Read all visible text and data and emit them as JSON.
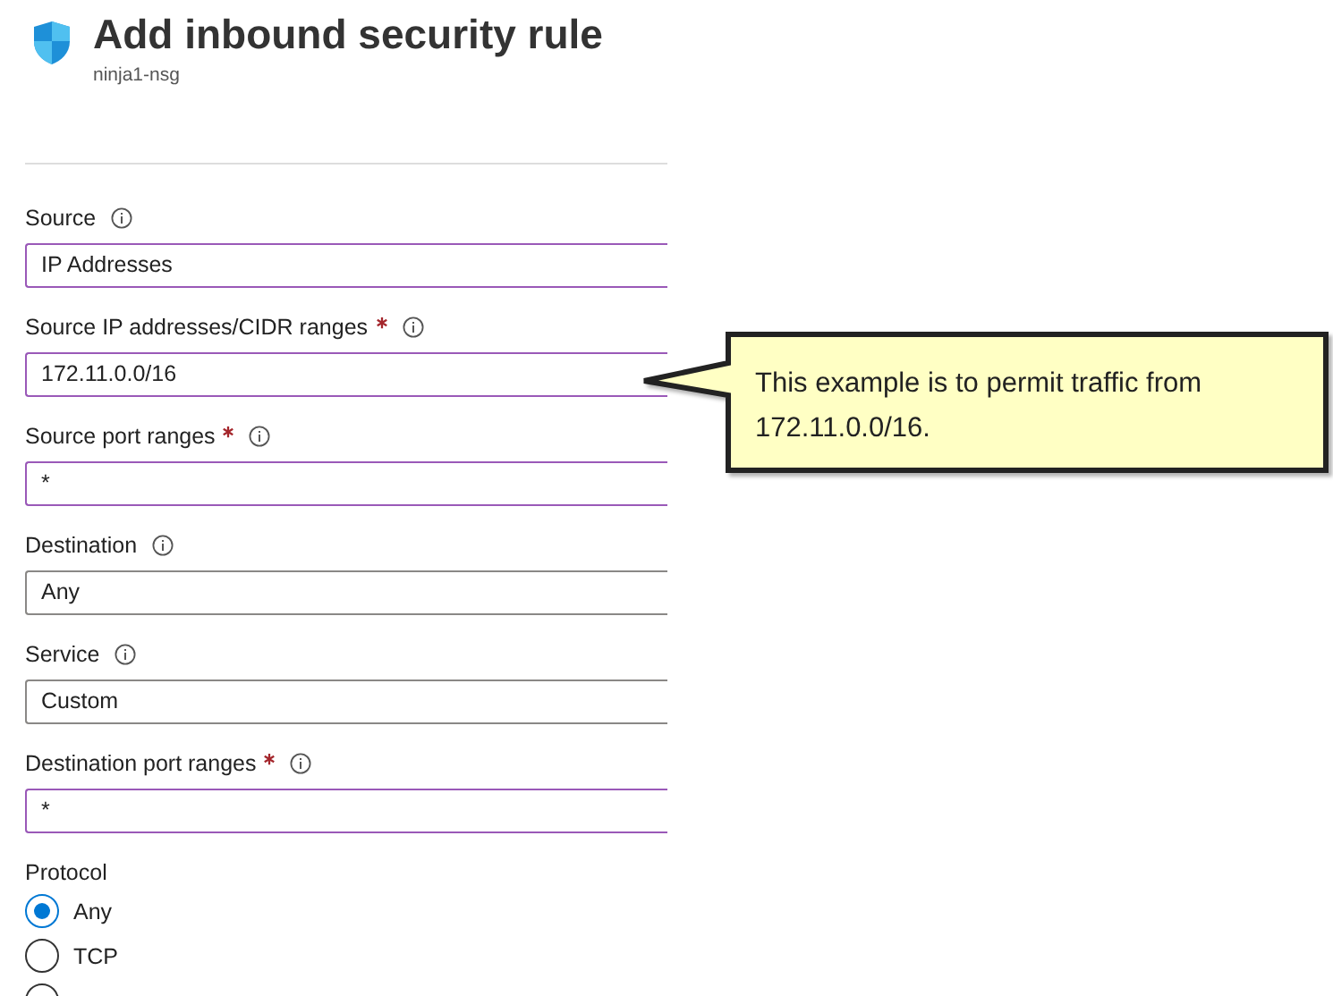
{
  "header": {
    "title": "Add inbound security rule",
    "subtitle": "ninja1-nsg"
  },
  "fields": [
    {
      "label": "Source",
      "required": false,
      "value": "IP Addresses",
      "highlighted": true
    },
    {
      "label": "Source IP addresses/CIDR ranges",
      "required": true,
      "value": "172.11.0.0/16",
      "highlighted": true
    },
    {
      "label": "Source port ranges",
      "required": true,
      "value": "*",
      "highlighted": true
    },
    {
      "label": "Destination",
      "required": false,
      "value": "Any",
      "highlighted": false
    },
    {
      "label": "Service",
      "required": false,
      "value": "Custom",
      "highlighted": false
    },
    {
      "label": "Destination port ranges",
      "required": true,
      "value": "*",
      "highlighted": true
    }
  ],
  "protocol": {
    "label": "Protocol",
    "options": [
      {
        "label": "Any",
        "selected": true
      },
      {
        "label": "TCP",
        "selected": false
      },
      {
        "selected": false
      }
    ]
  },
  "callout": {
    "text": "This example is to permit traffic from 172.11.0.0/16."
  }
}
